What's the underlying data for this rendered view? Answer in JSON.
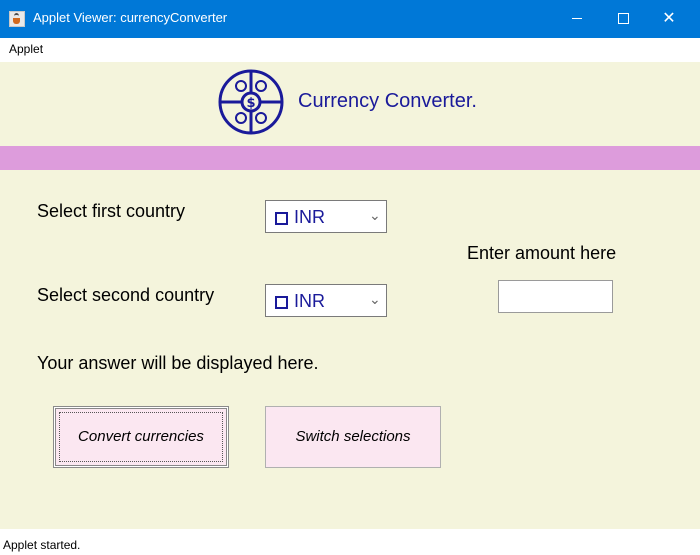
{
  "window": {
    "title": "Applet Viewer: currencyConverter"
  },
  "menu": {
    "items": [
      "Applet"
    ]
  },
  "header": {
    "title": "Currency Converter."
  },
  "form": {
    "first_label": "Select first country",
    "second_label": "Select second country",
    "first_value": "INR",
    "second_value": "INR",
    "amount_label": "Enter amount here",
    "amount_value": "",
    "result_text": "Your answer will be displayed here."
  },
  "buttons": {
    "convert": "Convert currencies",
    "switch": "Switch selections"
  },
  "status": {
    "text": "Applet started."
  },
  "colors": {
    "titlebar": "#0078d7",
    "applet_bg": "#f4f4dc",
    "accent_band": "#dd9cdc",
    "heading": "#1a1a9a",
    "button_bg": "#fbe7f1"
  },
  "icons": {
    "app": "java-cup-icon",
    "logo": "currency-globe-logo",
    "dropdown": "chevron-down-icon"
  }
}
